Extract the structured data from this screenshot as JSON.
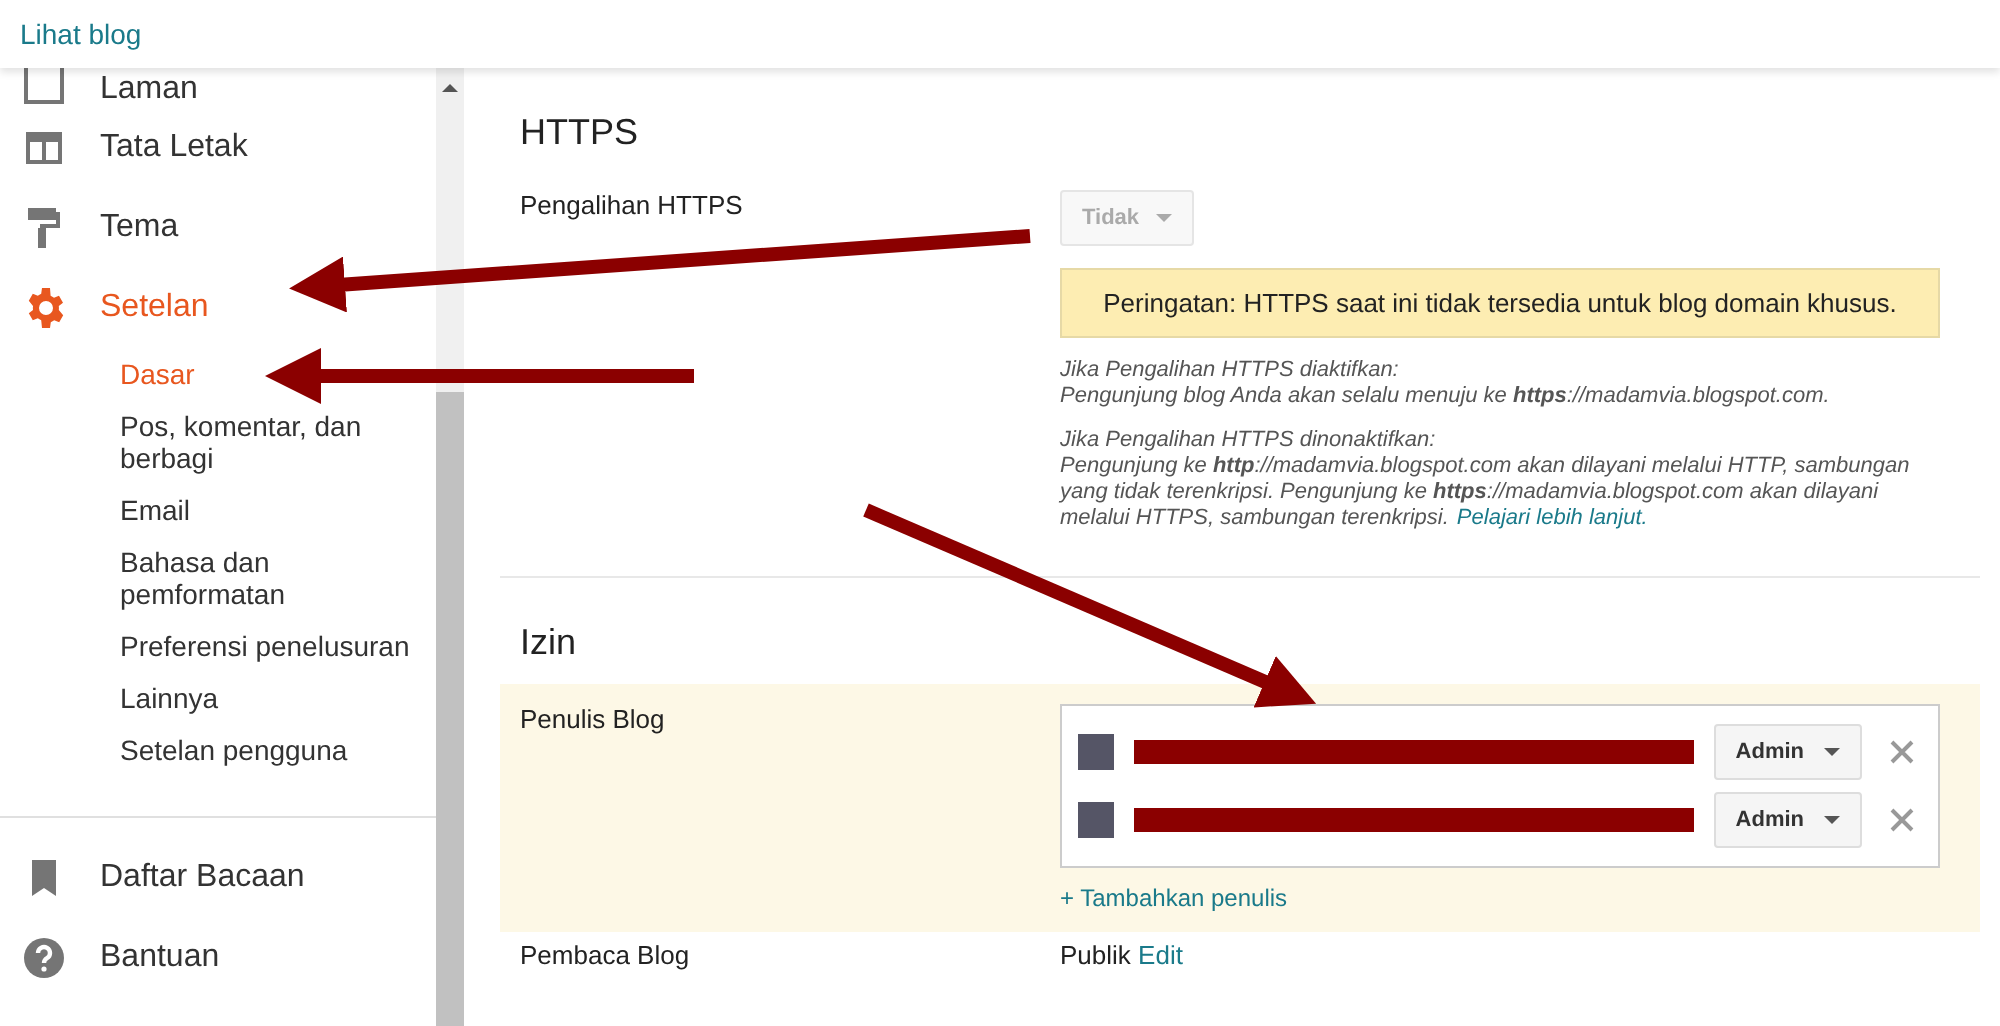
{
  "topbar": {
    "link": "Lihat blog"
  },
  "sidebar": {
    "items": [
      {
        "label": "Laman",
        "selected": false
      },
      {
        "label": "Tata Letak",
        "selected": false
      },
      {
        "label": "Tema",
        "selected": false
      },
      {
        "label": "Setelan",
        "selected": true,
        "children": [
          {
            "label": "Dasar",
            "selected": true
          },
          {
            "label": "Pos, komentar, dan berbagi",
            "selected": false
          },
          {
            "label": "Email",
            "selected": false
          },
          {
            "label": "Bahasa dan pemformatan",
            "selected": false
          },
          {
            "label": "Preferensi penelusuran",
            "selected": false
          },
          {
            "label": "Lainnya",
            "selected": false
          },
          {
            "label": "Setelan pengguna",
            "selected": false
          }
        ]
      }
    ],
    "bottom_items": [
      {
        "label": "Daftar Bacaan",
        "selected": false
      },
      {
        "label": "Bantuan",
        "selected": false
      }
    ]
  },
  "https": {
    "heading": "HTTPS",
    "label": "Pengalihan HTTPS",
    "dropdown": {
      "value": "Tidak",
      "disabled": true
    },
    "warning": "Peringatan: HTTPS saat ini tidak tersedia untuk blog domain khusus.",
    "notes": [
      "Jika Pengalihan HTTPS diaktifkan:",
      "Pengunjung blog Anda akan selalu menuju ke **https**://madamvia.blogspot.com.",
      "Jika Pengalihan HTTPS dinonaktifkan:",
      "Pengunjung ke **http**://madamvia.blogspot.com akan dilayani melalui HTTP, sambungan yang tidak terenkripsi. Pengunjung ke **https**://madamvia.blogspot.com akan dilayani melalui HTTPS, sambungan terenkripsi."
    ],
    "learn_more": "Pelajari lebih lanjut."
  },
  "izin": {
    "heading": "Izin",
    "authors_label": "Penulis Blog",
    "authors": [
      {
        "role": "Admin"
      },
      {
        "role": "Admin"
      }
    ],
    "add_author": "+ Tambahkan penulis",
    "readers_label": "Pembaca Blog",
    "readers_value": "Publik",
    "readers_edit": "Edit"
  }
}
